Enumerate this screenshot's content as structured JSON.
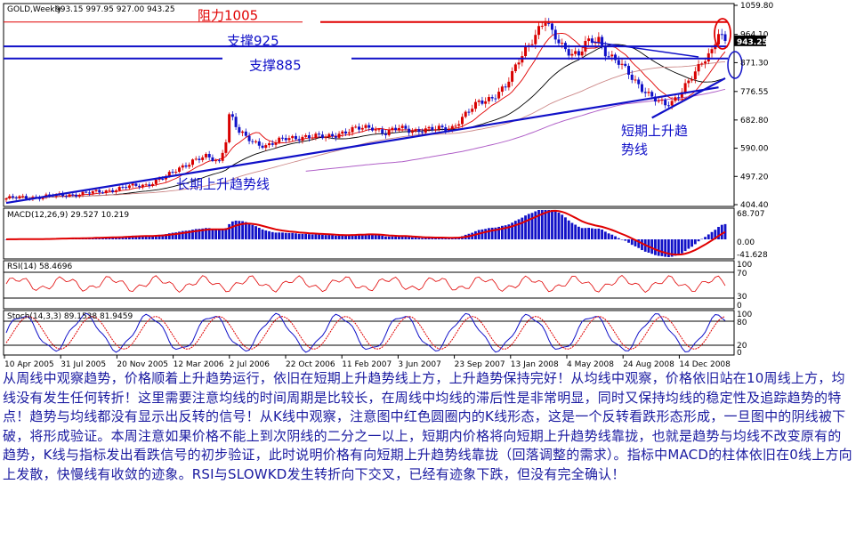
{
  "chart_data": [
    {
      "type": "candlestick",
      "title": "GOLD,Weekly",
      "ohlc_readout": [
        "993.15",
        "997.95",
        "927.00",
        "943.25"
      ],
      "price_label": "943.25",
      "ylim": [
        404.4,
        1059.8
      ],
      "y_ticks": [
        "1059.80",
        "964.10",
        "871.30",
        "776.55",
        "682.80",
        "590.00",
        "497.20",
        "404.40"
      ],
      "x_ticks": [
        "10 Apr 2005",
        "31 Jul 2005",
        "20 Nov 2005",
        "12 Mar 2006",
        "2 Jul 2006",
        "22 Oct 2006",
        "11 Feb 2007",
        "3 Jun 2007",
        "23 Sep 2007",
        "13 Jan 2008",
        "4 May 2008",
        "24 Aug 2008",
        "14 Dec 2008"
      ],
      "price_path": [
        [
          0,
          425
        ],
        [
          10,
          430
        ],
        [
          20,
          438
        ],
        [
          28,
          446
        ],
        [
          36,
          462
        ],
        [
          42,
          470
        ],
        [
          48,
          495
        ],
        [
          52,
          525
        ],
        [
          56,
          550
        ],
        [
          60,
          560
        ],
        [
          64,
          545
        ],
        [
          66,
          620
        ],
        [
          67,
          700
        ],
        [
          68,
          690
        ],
        [
          70,
          640
        ],
        [
          74,
          610
        ],
        [
          78,
          600
        ],
        [
          84,
          620
        ],
        [
          90,
          630
        ],
        [
          96,
          625
        ],
        [
          100,
          640
        ],
        [
          104,
          650
        ],
        [
          110,
          660
        ],
        [
          114,
          640
        ],
        [
          118,
          655
        ],
        [
          122,
          650
        ],
        [
          128,
          650
        ],
        [
          134,
          660
        ],
        [
          138,
          700
        ],
        [
          142,
          740
        ],
        [
          146,
          760
        ],
        [
          150,
          790
        ],
        [
          152,
          830
        ],
        [
          154,
          880
        ],
        [
          156,
          920
        ],
        [
          158,
          950
        ],
        [
          160,
          980
        ],
        [
          162,
          1005
        ],
        [
          164,
          965
        ],
        [
          168,
          920
        ],
        [
          170,
          905
        ],
        [
          172,
          895
        ],
        [
          174,
          930
        ],
        [
          178,
          950
        ],
        [
          180,
          910
        ],
        [
          184,
          870
        ],
        [
          188,
          820
        ],
        [
          192,
          780
        ],
        [
          194,
          760
        ],
        [
          196,
          740
        ],
        [
          198,
          730
        ],
        [
          200,
          740
        ],
        [
          204,
          800
        ],
        [
          208,
          850
        ],
        [
          210,
          880
        ],
        [
          212,
          910
        ],
        [
          214,
          980
        ],
        [
          216,
          943
        ]
      ],
      "annotations": [
        "阻力1005",
        "支撑925",
        "支撑885",
        "长期上升趋势线",
        "短期上升趋",
        "势线"
      ],
      "levels": {
        "resistance": 1005,
        "support1": 925,
        "support2": 885
      },
      "colors": {
        "up": "#d80000",
        "down": "#1010c8",
        "trend": "#1010c8",
        "resistance": "#e00000",
        "ma_short": "#e00000",
        "ma_mid": "#000000",
        "ma_long": "#cc8888",
        "ma_longest": "#b060c8"
      }
    },
    {
      "type": "histogram",
      "title": "MACD(12,26,9) 29.527 10.219",
      "y_ticks": [
        "68.707",
        "0.00",
        "-41.628"
      ],
      "ylim": [
        -41.628,
        68.707
      ]
    },
    {
      "type": "line",
      "title": "RSI(14) 58.4696",
      "y_ticks": [
        "100",
        "70",
        "30",
        "0"
      ],
      "ylim": [
        0,
        100
      ]
    },
    {
      "type": "line",
      "title": "Stoch(14,3,3) 89.1538 81.9459",
      "y_ticks": [
        "100",
        "80",
        "20",
        "0"
      ],
      "ylim": [
        0,
        100
      ]
    }
  ],
  "commentary": "从周线中观察趋势，价格顺着上升趋势运行，依旧在短期上升趋势线上方，上升趋势保持完好！从均线中观察，价格依旧站在10周线上方，均线没有发生任何转折！这里需要注意均线的时间周期是比较长，在周线中均线的滞后性是非常明显，同时又保持均线的稳定性及追踪趋势的特点！趋势与均线都没有显示出反转的信号！从K线中观察，注意图中红色圆圈内的K线形态，这是一个反转看跌形态形成，一旦图中的阴线被下破，将形成验证。本周注意如果价格不能上到次阴线的二分之一以上，短期内价格将向短期上升趋势线靠拢，也就是趋势与均线不改变原有的趋势，K线与指标发出看跌信号的初步验证，此时说明价格有向短期上升趋势线靠拢（回落调整的需求）。指标中MACD的柱体依旧在0线上方向上发散，快慢线有收敛的迹象。RSI与SLOWKD发生转折向下交叉，已经有迹象下跌，但没有完全确认！"
}
